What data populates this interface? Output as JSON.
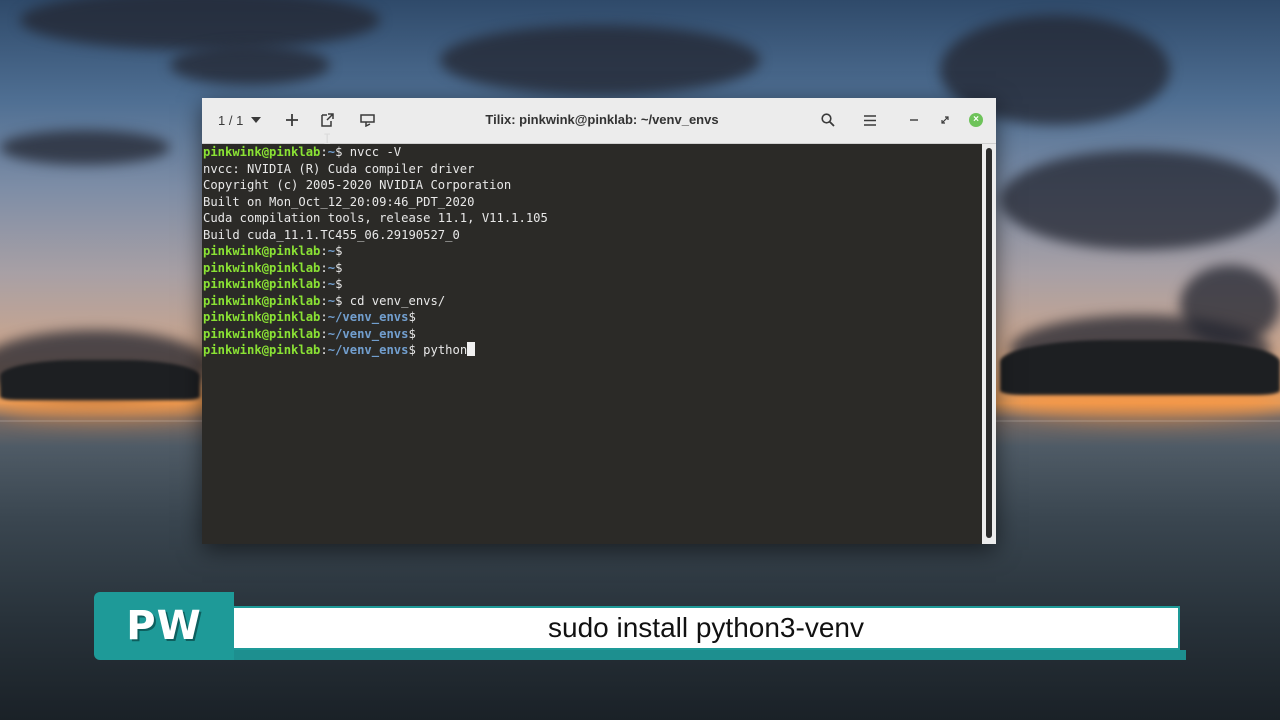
{
  "window": {
    "title": "Tilix: pinkwink@pinklab: ~/venv_envs",
    "session_counter": "1 / 1"
  },
  "titlebar_icons": {
    "session_menu": "chevron-down-icon",
    "add_terminal": "plus-icon",
    "detach": "detach-icon",
    "sync_input": "sync-input-icon",
    "search": "search-icon",
    "menu": "hamburger-menu-icon",
    "minimize": "minimize-icon",
    "maximize": "maximize-icon",
    "close": "close-icon"
  },
  "terminal": {
    "prompt_user": "pinkwink@pinklab",
    "lines": [
      {
        "type": "prompt",
        "path": "~",
        "command": "nvcc -V"
      },
      {
        "type": "output",
        "text": "nvcc: NVIDIA (R) Cuda compiler driver"
      },
      {
        "type": "output",
        "text": "Copyright (c) 2005-2020 NVIDIA Corporation"
      },
      {
        "type": "output",
        "text": "Built on Mon_Oct_12_20:09:46_PDT_2020"
      },
      {
        "type": "output",
        "text": "Cuda compilation tools, release 11.1, V11.1.105"
      },
      {
        "type": "output",
        "text": "Build cuda_11.1.TC455_06.29190527_0"
      },
      {
        "type": "prompt",
        "path": "~",
        "command": ""
      },
      {
        "type": "prompt",
        "path": "~",
        "command": ""
      },
      {
        "type": "prompt",
        "path": "~",
        "command": ""
      },
      {
        "type": "prompt",
        "path": "~",
        "command": "cd venv_envs/"
      },
      {
        "type": "prompt",
        "path": "~/venv_envs",
        "command": ""
      },
      {
        "type": "prompt",
        "path": "~/venv_envs",
        "command": ""
      },
      {
        "type": "prompt",
        "path": "~/venv_envs",
        "command": "python",
        "cursor": true
      }
    ]
  },
  "caption": {
    "logo": "PW",
    "text": "sudo install python3-venv"
  },
  "colors": {
    "prompt_user": "#8ae234",
    "prompt_path": "#729fcf",
    "terminal_bg": "#2b2a28",
    "caption_accent": "#1e9a98",
    "close_button": "#6ec35a"
  }
}
